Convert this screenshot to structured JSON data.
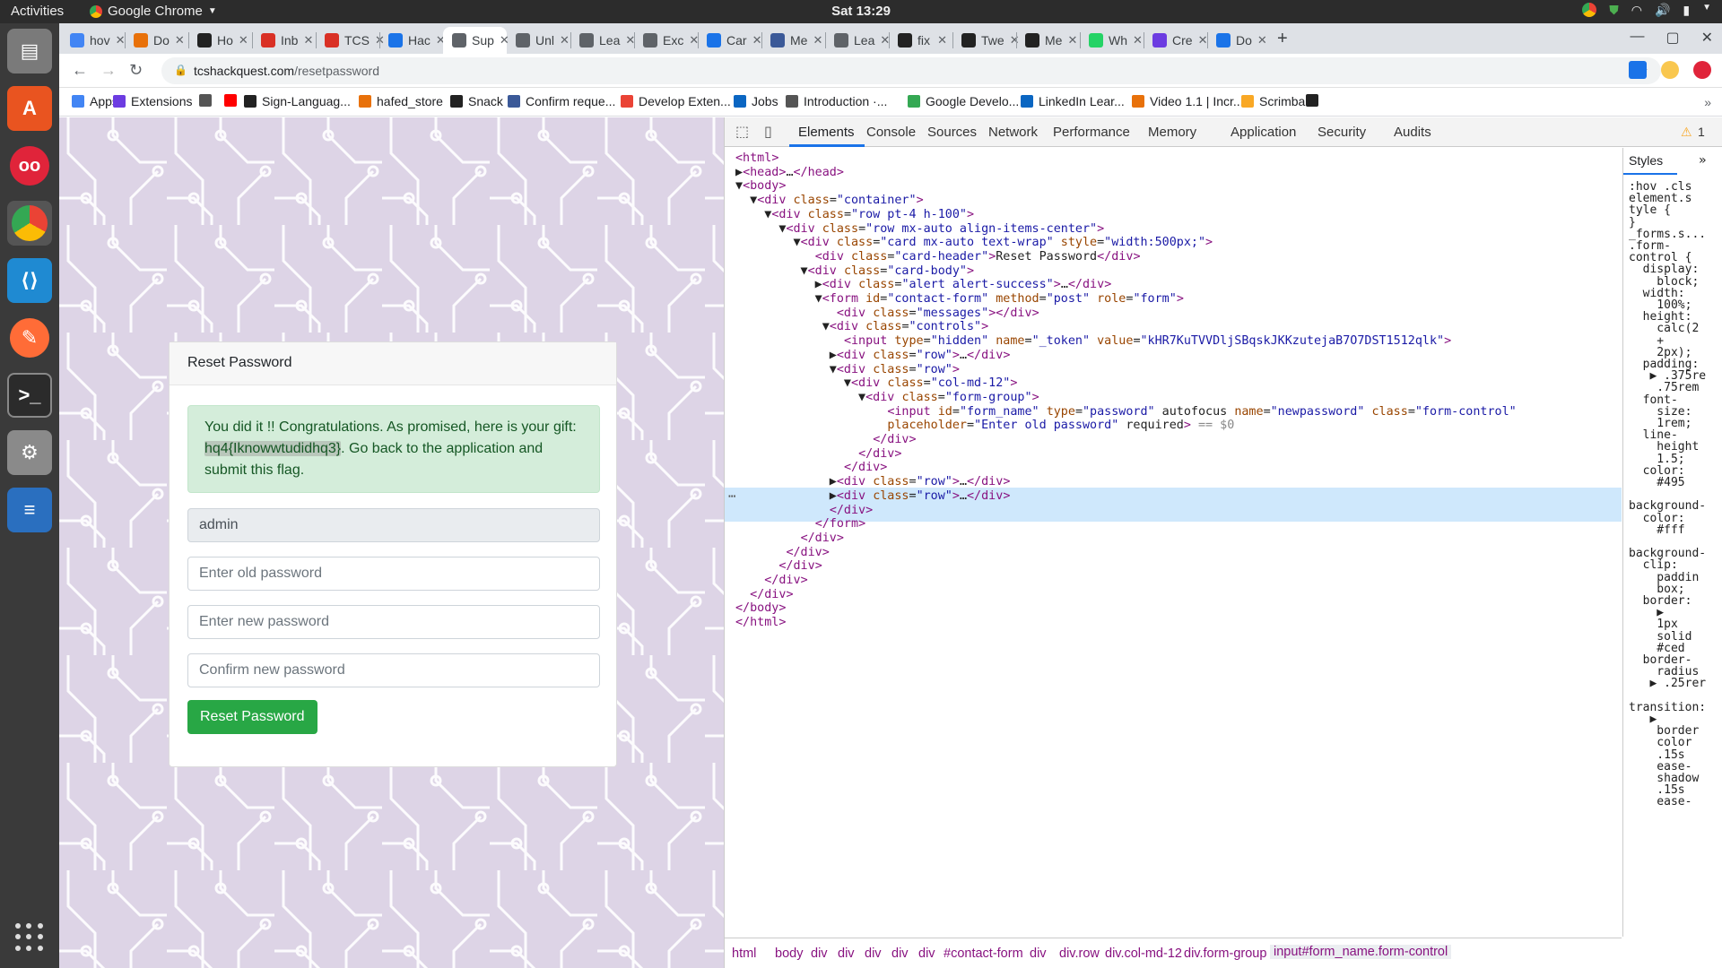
{
  "topbar": {
    "activities": "Activities",
    "app_name": "Google Chrome",
    "clock": "Sat 13:29"
  },
  "tabs": [
    {
      "label": "hov",
      "color": "#4285f4"
    },
    {
      "label": "Do",
      "color": "#e8710a"
    },
    {
      "label": "Ho",
      "color": "#222222"
    },
    {
      "label": "Inb",
      "color": "#d93025"
    },
    {
      "label": "TCS",
      "color": "#d93025"
    },
    {
      "label": "Hac",
      "color": "#1a73e8"
    },
    {
      "label": "Sup",
      "color": "#5f6368"
    },
    {
      "label": "Unl",
      "color": "#5f6368"
    },
    {
      "label": "Lea",
      "color": "#5f6368"
    },
    {
      "label": "Exc",
      "color": "#5f6368"
    },
    {
      "label": "Car",
      "color": "#1a73e8"
    },
    {
      "label": "Me",
      "color": "#3b5998"
    },
    {
      "label": "Lea",
      "color": "#5f6368"
    },
    {
      "label": "fix",
      "color": "#222222"
    },
    {
      "label": "Twe",
      "color": "#222222"
    },
    {
      "label": "Me",
      "color": "#222222"
    },
    {
      "label": "Wh",
      "color": "#25d366"
    },
    {
      "label": "Cre",
      "color": "#6c3ce1"
    },
    {
      "label": "Do",
      "color": "#1a73e8"
    }
  ],
  "omnibox": {
    "domain": "tcshackquest.com",
    "path": "/resetpassword"
  },
  "bookmarks": [
    {
      "label": "Apps",
      "color": "#4285f4"
    },
    {
      "label": "Extensions",
      "color": "#6c3ce1"
    },
    {
      "label": "",
      "color": "#555555"
    },
    {
      "label": "",
      "color": "#ff0000"
    },
    {
      "label": "Sign-Languag...",
      "color": "#222222"
    },
    {
      "label": "hafed_store",
      "color": "#e8710a"
    },
    {
      "label": "Snack",
      "color": "#222222"
    },
    {
      "label": "Confirm reque...",
      "color": "#3b5998"
    },
    {
      "label": "Develop Exten...",
      "color": "#ea4335"
    },
    {
      "label": "Jobs",
      "color": "#0a66c2"
    },
    {
      "label": "Introduction ·...",
      "color": "#555555"
    },
    {
      "label": "Google Develo...",
      "color": "#34a853"
    },
    {
      "label": "LinkedIn Lear...",
      "color": "#0a66c2"
    },
    {
      "label": "Video 1.1 | Incr...",
      "color": "#e8710a"
    },
    {
      "label": "Scrimba",
      "color": "#f9a825"
    },
    {
      "label": "",
      "color": "#222222"
    }
  ],
  "card": {
    "header": "Reset Password",
    "alert_before": "You did it !! Congratulations. As promised, here is your gift: ",
    "flag": "hq4{Iknowwtudidhq3}",
    "alert_after": ". Go back to the application and submit this flag.",
    "username": "admin",
    "old_placeholder": "Enter old password",
    "new_placeholder": "Enter new password",
    "confirm_placeholder": "Confirm new password",
    "button": "Reset Password"
  },
  "devtools": {
    "tabs": [
      "Elements",
      "Console",
      "Sources",
      "Network",
      "Performance",
      "Memory",
      "Application",
      "Security",
      "Audits"
    ],
    "warnings": "1",
    "dom_lines": [
      "<html>",
      "▶<head>…</head>",
      "▼<body>",
      "  ▼<div class=\"container\">",
      "    ▼<div class=\"row pt-4 h-100\">",
      "      ▼<div class=\"row mx-auto align-items-center\">",
      "        ▼<div class=\"card mx-auto text-wrap\" style=\"width:500px;\">",
      "           <div class=\"card-header\">Reset Password</div>",
      "         ▼<div class=\"card-body\">",
      "           ▶<div class=\"alert alert-success\">…</div>",
      "           ▼<form id=\"contact-form\" method=\"post\" role=\"form\">",
      "              <div class=\"messages\"></div>",
      "            ▼<div class=\"controls\">",
      "               <input type=\"hidden\" name=\"_token\" value=\"kHR7KuTVVDljSBqskJKKzutejaB7O7DST1512qlk\">",
      "             ▶<div class=\"row\">…</div>",
      "             ▼<div class=\"row\">",
      "               ▼<div class=\"col-md-12\">",
      "                 ▼<div class=\"form-group\">",
      "                     <input id=\"form_name\" type=\"password\" autofocus name=\"newpassword\" class=\"form-control\"",
      "                     placeholder=\"Enter old password\" required> == $0",
      "                   </div>",
      "                 </div>",
      "               </div>",
      "             ▶<div class=\"row\">…</div>",
      "             ▶<div class=\"row\">…</div>",
      "             </div>",
      "           </form>",
      "         </div>",
      "       </div>",
      "      </div>",
      "    </div>",
      "  </div>",
      "</body>",
      "</html>"
    ],
    "styles_tab": "Styles",
    "styles_lines": [
      ":hov .cls",
      "element.s",
      "tyle {",
      "}",
      "_forms.s...",
      ".form-",
      "control {",
      "  display:",
      "    block;",
      "  width:",
      "    100%;",
      "  height:",
      "    calc(2",
      "    +",
      "    2px);",
      "  padding:",
      "   ▶ .375re",
      "    .75rem",
      "  font-",
      "    size:",
      "    1rem;",
      "  line-",
      "    height",
      "    1.5;",
      "  color:",
      "    #495",
      "",
      "background-",
      "  color:",
      "    #fff",
      "",
      "background-",
      "  clip:",
      "    paddin",
      "    box;",
      "  border:",
      "    ▶",
      "    1px",
      "    solid",
      "    #ced",
      "  border-",
      "    radius",
      "   ▶ .25rer",
      "",
      "transition:",
      "   ▶",
      "    border",
      "    color",
      "    .15s",
      "    ease-",
      "    shadow",
      "    .15s",
      "    ease-"
    ],
    "breadcrumbs": [
      "html",
      "body",
      "div",
      "div",
      "div",
      "div",
      "div",
      "#contact-form",
      "div",
      "div.row",
      "div.col-md-12",
      "div.form-group",
      "input#form_name.form-control"
    ]
  }
}
